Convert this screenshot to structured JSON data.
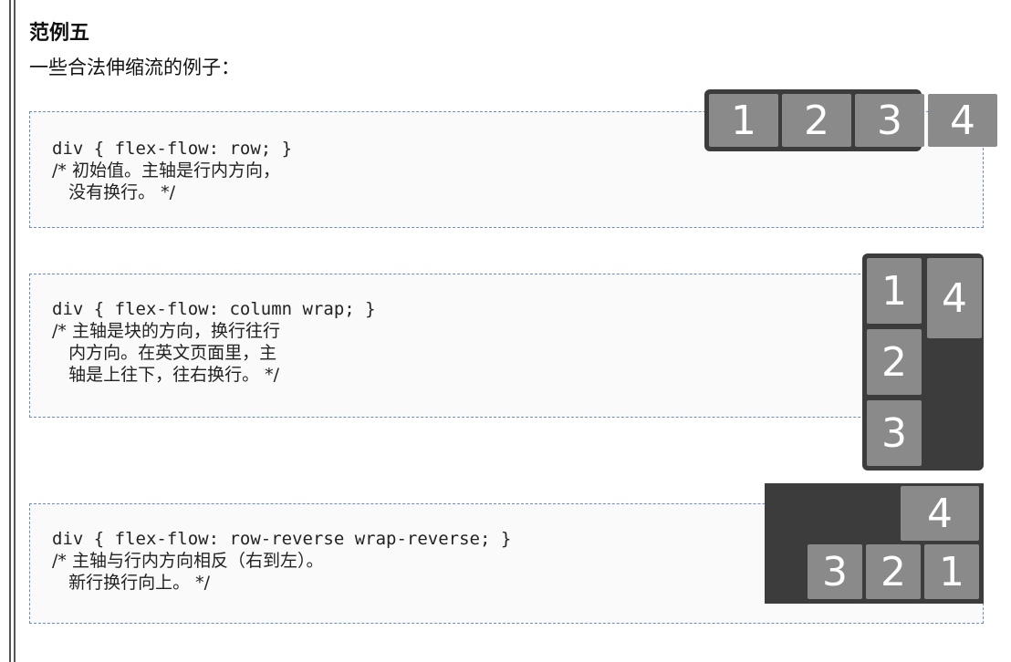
{
  "heading": "范例五",
  "intro": "一些合法伸缩流的例子：",
  "examples": [
    {
      "code": "div { flex-flow: row; }",
      "comment_lines": [
        "/* 初始值。主轴是行内方向，",
        "   没有换行。 */"
      ],
      "demo_items": [
        "1",
        "2",
        "3",
        "4"
      ]
    },
    {
      "code": "div { flex-flow: column wrap; }",
      "comment_lines": [
        "/* 主轴是块的方向，换行往行",
        "   内方向。在英文页面里，主",
        "   轴是上往下，往右换行。 */"
      ],
      "demo_items": [
        "1",
        "2",
        "3",
        "4"
      ]
    },
    {
      "code": "div { flex-flow: row-reverse wrap-reverse; }",
      "comment_lines": [
        "/* 主轴与行内方向相反（右到左）。",
        "   新行换行向上。 */"
      ],
      "demo_items": [
        "1",
        "2",
        "3",
        "4"
      ]
    }
  ],
  "colors": {
    "demo_background": "#3c3c3c",
    "demo_item": "#8a8a8a",
    "border_dashed": "#6a8fbf"
  }
}
